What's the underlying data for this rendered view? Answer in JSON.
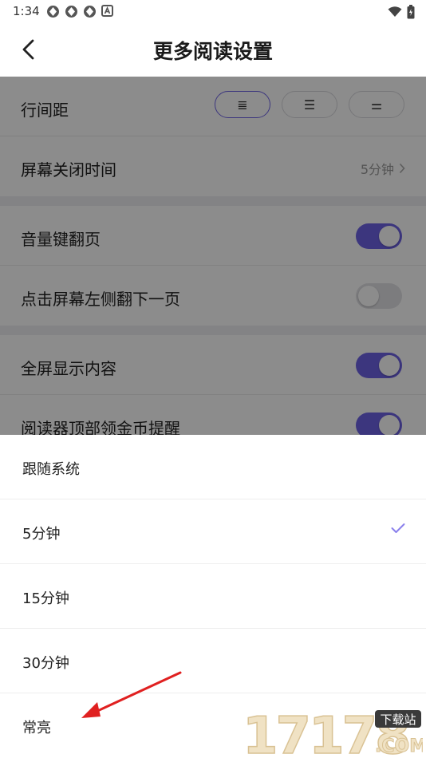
{
  "status_bar": {
    "time": "1:34",
    "left_icons": [
      "app-notification-icon",
      "app-notification-icon",
      "app-notification-icon",
      "a-letter-icon"
    ],
    "right_icons": [
      "wifi-icon",
      "battery-icon"
    ]
  },
  "header": {
    "title": "更多阅读设置",
    "back_icon": "chevron-left-icon"
  },
  "settings": {
    "line_spacing": {
      "label": "行间距",
      "options": [
        "≣",
        "☰",
        "⚌"
      ],
      "selected_index": 0
    },
    "screen_off": {
      "label": "屏幕关闭时间",
      "value": "5分钟"
    },
    "volume_page_turn": {
      "label": "音量键翻页",
      "enabled": true
    },
    "tap_left_next": {
      "label": "点击屏幕左侧翻下一页",
      "enabled": false
    },
    "fullscreen": {
      "label": "全屏显示内容",
      "enabled": true
    },
    "coin_reminder": {
      "label": "阅读器顶部领金币提醒",
      "enabled": true
    }
  },
  "sheet": {
    "options": [
      "跟随系统",
      "5分钟",
      "15分钟",
      "30分钟",
      "常亮"
    ],
    "selected_index": 1
  },
  "colors": {
    "accent": "#6e63e6",
    "annotation_arrow": "#e02020"
  },
  "watermark": {
    "text": "17178",
    "badge": "下载站",
    "domain": ".COM"
  }
}
